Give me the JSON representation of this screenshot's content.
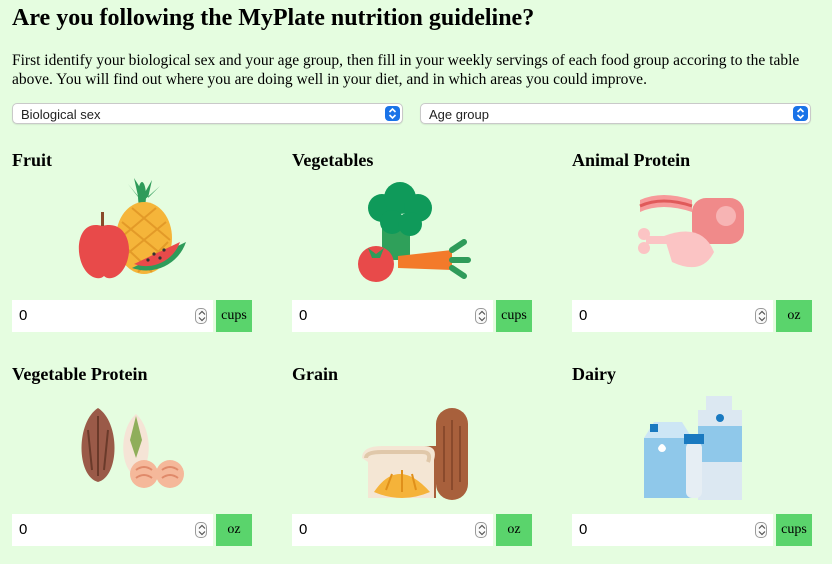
{
  "header": {
    "title": "Are you following the MyPlate nutrition guideline?",
    "intro": "First identify your biological sex and your age group, then fill in your weekly servings of each food group accoring to the table above. You will find out where you are doing well in your diet, and in which areas you could improve."
  },
  "selects": {
    "sex": "Biological sex",
    "age": "Age group"
  },
  "groups": [
    {
      "title": "Fruit",
      "value": "0",
      "unit": "cups",
      "icon": "fruit-icon"
    },
    {
      "title": "Vegetables",
      "value": "0",
      "unit": "cups",
      "icon": "vegetables-icon"
    },
    {
      "title": "Animal Protein",
      "value": "0",
      "unit": "oz",
      "icon": "animal-protein-icon"
    },
    {
      "title": "Vegetable Protein",
      "value": "0",
      "unit": "oz",
      "icon": "vegetable-protein-icon"
    },
    {
      "title": "Grain",
      "value": "0",
      "unit": "oz",
      "icon": "grain-icon"
    },
    {
      "title": "Dairy",
      "value": "0",
      "unit": "cups",
      "icon": "dairy-icon"
    }
  ],
  "colors": {
    "background": "#e5fde0",
    "unit_badge": "#5ad46c",
    "select_chevron": "#1a73e8"
  }
}
